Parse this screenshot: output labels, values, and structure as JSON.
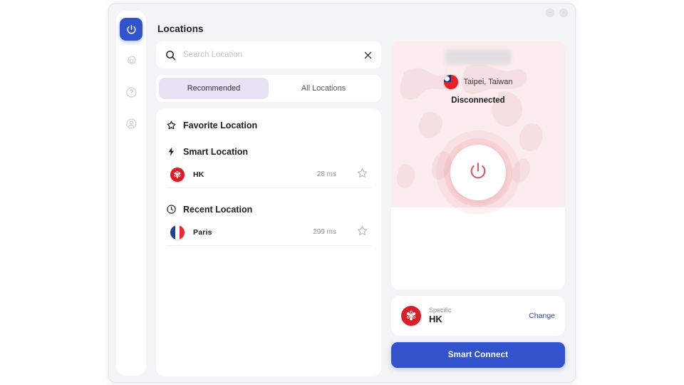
{
  "window": {
    "controls": [
      {
        "name": "minimize-button",
        "glyph": "−"
      },
      {
        "name": "close-button",
        "glyph": "×"
      }
    ]
  },
  "sidebar": {
    "items": [
      {
        "icon": "power-icon",
        "name": "sidebar-item-power",
        "active": true
      },
      {
        "icon": "gear-icon",
        "name": "sidebar-item-settings",
        "active": false
      },
      {
        "icon": "help-circle-icon",
        "name": "sidebar-item-help",
        "active": false
      },
      {
        "icon": "user-circle-icon",
        "name": "sidebar-item-account",
        "active": false
      }
    ]
  },
  "header": {
    "title": "Locations"
  },
  "search": {
    "placeholder": "Search Location",
    "value": "",
    "search_icon": "search-icon",
    "clear_icon": "close-icon"
  },
  "tabs": [
    {
      "label": "Recommended",
      "active": true
    },
    {
      "label": "All Locations",
      "active": false
    }
  ],
  "sections": [
    {
      "icon": "star-icon",
      "title": "Favorite Location",
      "rows": []
    },
    {
      "icon": "lightning-icon",
      "title": "Smart Location",
      "rows": [
        {
          "flag": "hk",
          "name": "HK",
          "ping": "28 ms",
          "favorite_icon": "star-icon"
        }
      ]
    },
    {
      "icon": "clock-icon",
      "title": "Recent Location",
      "rows": [
        {
          "flag": "fr",
          "name": "Paris",
          "ping": "299 ms",
          "favorite_icon": "star-icon"
        }
      ]
    }
  ],
  "map_panel": {
    "redacted_field": "",
    "server_flag": "tw",
    "server_label": "Taipei, Taiwan",
    "status": "Disconnected",
    "power_icon": "power-icon"
  },
  "specific_card": {
    "flag": "hk",
    "kicker": "Specific",
    "value": "HK",
    "change_label": "Change"
  },
  "connect": {
    "label": "Smart Connect"
  },
  "colors": {
    "accent_blue": "#3353cc",
    "tab_active_bg": "#e7e3f5",
    "map_pink": "#fbeced",
    "power_red": "#d9606e",
    "ping_text": "#8b8fa8",
    "change_link": "#3a4b9e"
  }
}
